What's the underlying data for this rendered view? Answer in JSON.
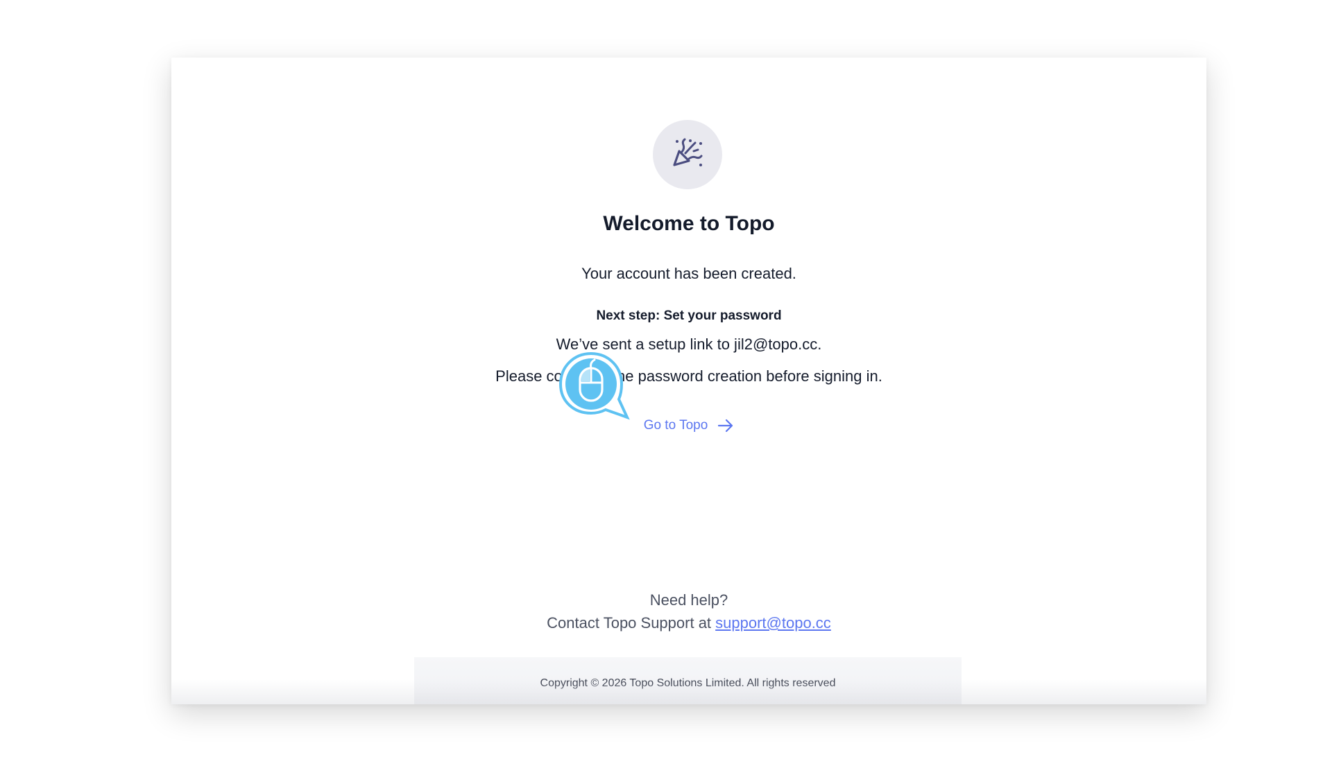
{
  "card": {
    "icon": "party-popper-icon",
    "title": "Welcome to Topo",
    "subtitle": "Your account has been created.",
    "next_step_heading": "Next step: Set your password",
    "sent_line": "We’ve sent a setup link to jil2@topo.cc.",
    "complete_line": "Please complete the password creation before signing in.",
    "go_link": "Go to Topo",
    "go_icon": "arrow-right-icon"
  },
  "help": {
    "title": "Need help?",
    "contact_prefix": "Contact Topo Support at ",
    "support_email": "support@topo.cc"
  },
  "footer": {
    "copyright": "Copyright © 2026 Topo Solutions Limited. All rights reserved"
  },
  "overlay": {
    "icon": "mouse-click-marker-icon"
  },
  "colors": {
    "accent": "#5b76f0",
    "title_text": "#141b2b",
    "muted_text": "#4a5060",
    "icon_circle": "#e9e9ef",
    "icon_color": "#4b4d80",
    "marker": "#5ec2f2"
  }
}
